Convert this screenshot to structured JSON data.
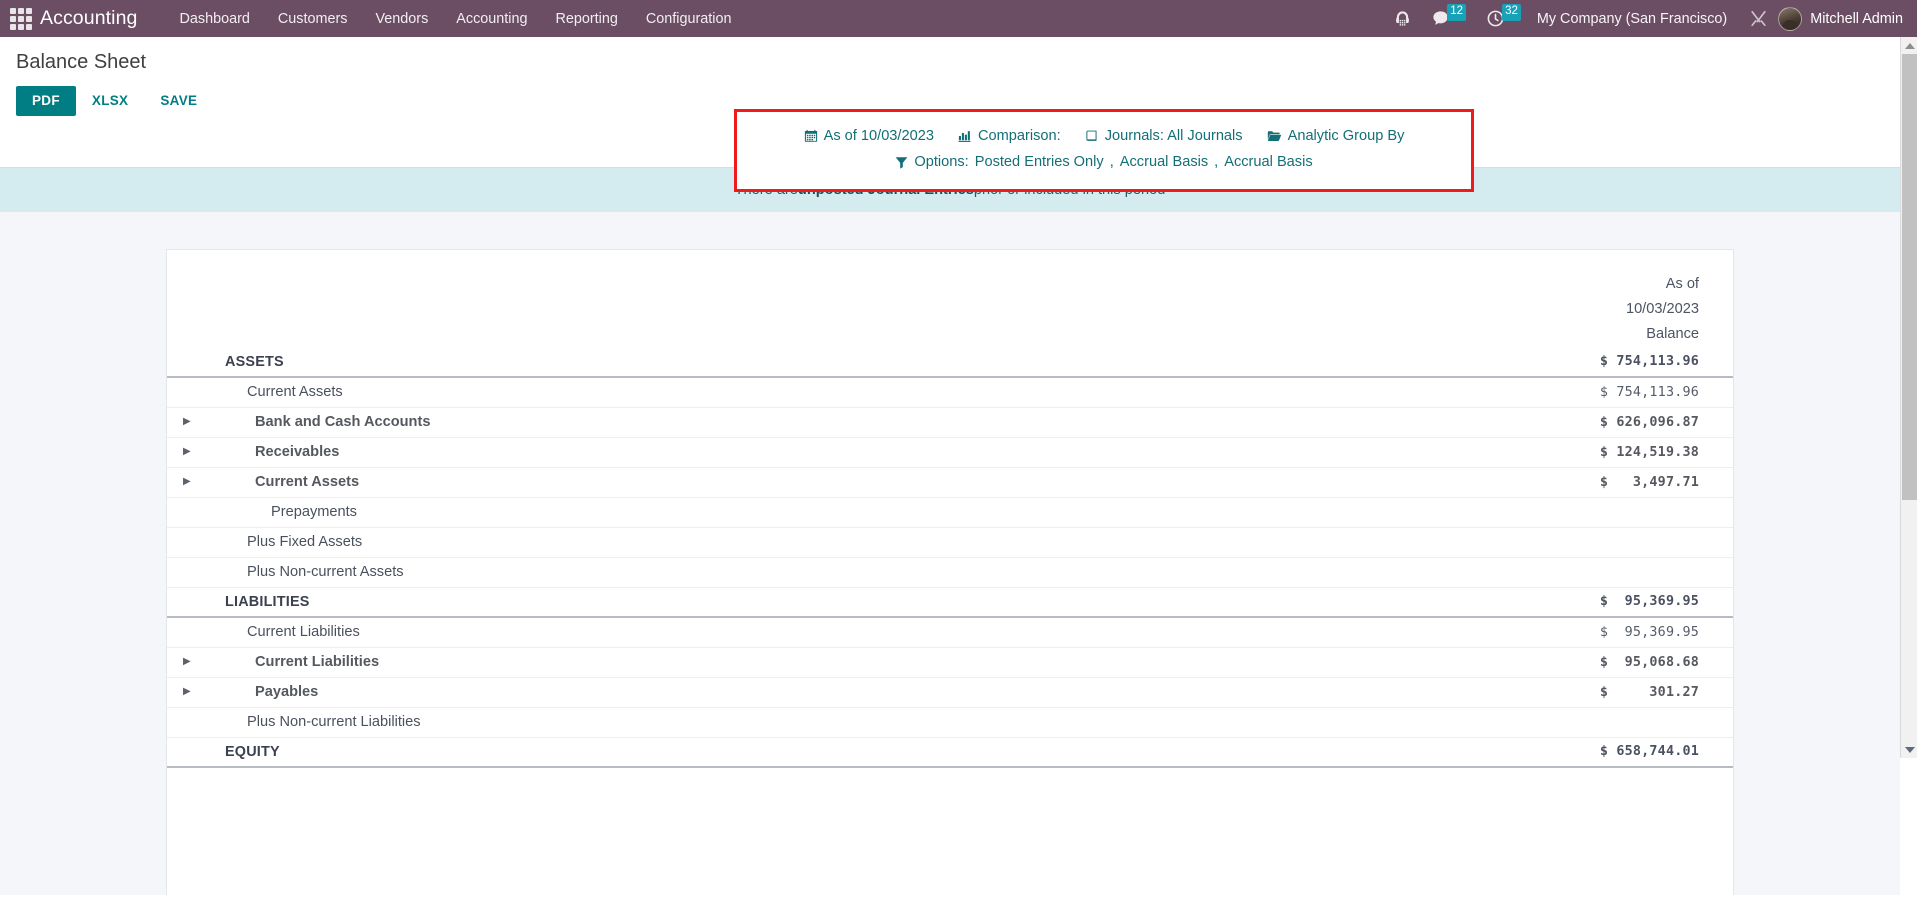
{
  "navbar": {
    "apps_icon": "apps-grid-icon",
    "brand": "Accounting",
    "menu": [
      {
        "label": "Dashboard"
      },
      {
        "label": "Customers"
      },
      {
        "label": "Vendors"
      },
      {
        "label": "Accounting"
      },
      {
        "label": "Reporting"
      },
      {
        "label": "Configuration"
      }
    ],
    "right": {
      "support_icon": "headset-icon",
      "messages_icon": "chat-bubble-icon",
      "messages_count": "12",
      "activities_icon": "clock-icon",
      "activities_count": "32",
      "company": "My Company (San Francisco)",
      "debug_icon": "wrench-icon",
      "avatar": "user-avatar",
      "user": "Mitchell Admin"
    }
  },
  "control_panel": {
    "title": "Balance Sheet",
    "buttons": {
      "pdf": "PDF",
      "xlsx": "XLSX",
      "save": "SAVE"
    },
    "filters": {
      "date": {
        "icon": "calendar-icon",
        "label": "As of 10/03/2023"
      },
      "comparison": {
        "icon": "bar-chart-icon",
        "label": "Comparison:"
      },
      "journals": {
        "icon": "book-icon",
        "label": "Journals: All Journals"
      },
      "analytic": {
        "icon": "folder-open-icon",
        "label": "Analytic Group By"
      },
      "options": {
        "icon": "funnel-icon",
        "label": "Options:",
        "values": [
          "Posted Entries Only",
          "Accrual Basis",
          "Accrual Basis"
        ],
        "separator": ","
      }
    },
    "highlight_color": "#ee1b1b"
  },
  "banner": {
    "prefix": "There are ",
    "strong": "unposted Journal Entries",
    "suffix": " prior or included in this period"
  },
  "report": {
    "header": {
      "as_of_line1": "As of",
      "as_of_line2": "10/03/2023",
      "balance": "Balance"
    },
    "rows": [
      {
        "label": "ASSETS",
        "value": "$ 754,113.96",
        "level": 0,
        "caret": false,
        "total_rule": true
      },
      {
        "label": "Current Assets",
        "value": "$ 754,113.96",
        "level": 1,
        "caret": false,
        "total_rule": false
      },
      {
        "label": "Bank and Cash Accounts",
        "value": "$ 626,096.87",
        "level": 2,
        "caret": true,
        "total_rule": false
      },
      {
        "label": "Receivables",
        "value": "$ 124,519.38",
        "level": 2,
        "caret": true,
        "total_rule": false
      },
      {
        "label": "Current Assets",
        "value": "$   3,497.71",
        "level": 2,
        "caret": true,
        "total_rule": false
      },
      {
        "label": "Prepayments",
        "value": "",
        "level": 3,
        "caret": false,
        "total_rule": false
      },
      {
        "label": "Plus Fixed Assets",
        "value": "",
        "level": 1,
        "caret": false,
        "total_rule": false
      },
      {
        "label": "Plus Non-current Assets",
        "value": "",
        "level": 1,
        "caret": false,
        "total_rule": false
      },
      {
        "label": "LIABILITIES",
        "value": "$  95,369.95",
        "level": 0,
        "caret": false,
        "total_rule": true
      },
      {
        "label": "Current Liabilities",
        "value": "$  95,369.95",
        "level": 1,
        "caret": false,
        "total_rule": false
      },
      {
        "label": "Current Liabilities",
        "value": "$  95,068.68",
        "level": 2,
        "caret": true,
        "total_rule": false
      },
      {
        "label": "Payables",
        "value": "$     301.27",
        "level": 2,
        "caret": true,
        "total_rule": false
      },
      {
        "label": "Plus Non-current Liabilities",
        "value": "",
        "level": 1,
        "caret": false,
        "total_rule": false
      },
      {
        "label": "EQUITY",
        "value": "$ 658,744.01",
        "level": 0,
        "caret": false,
        "total_rule": true
      }
    ]
  },
  "scrollbar": {
    "up_icon": "scroll-up-arrow",
    "down_icon": "scroll-down-arrow",
    "thumb": "scroll-thumb"
  }
}
